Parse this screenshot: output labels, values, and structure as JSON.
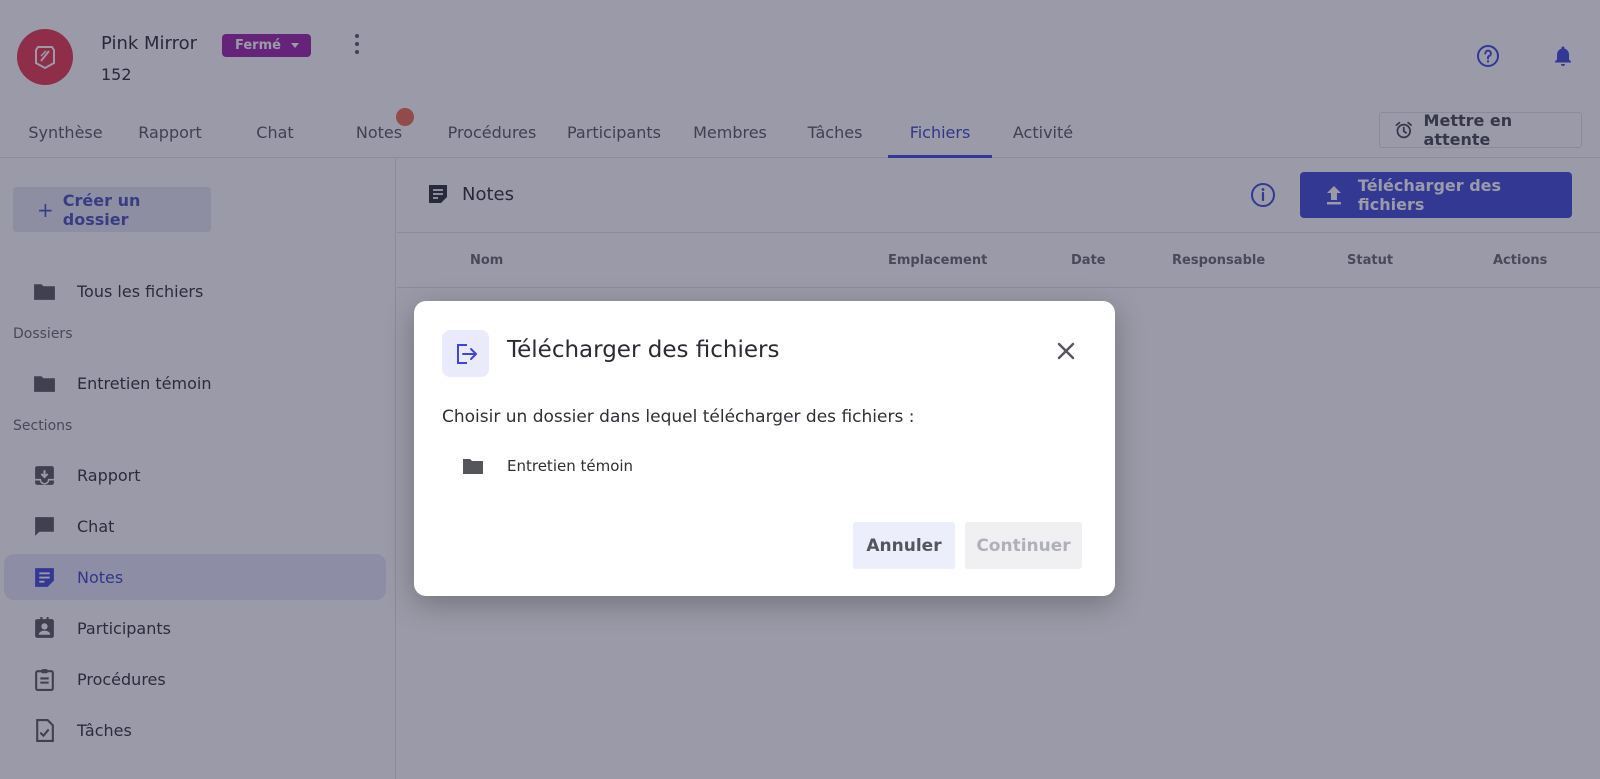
{
  "header": {
    "case_name": "Pink Mirror",
    "case_number": "152",
    "status": "Fermé",
    "hold_button": "Mettre en attente"
  },
  "tabs": [
    {
      "label": "Synthèse"
    },
    {
      "label": "Rapport"
    },
    {
      "label": "Chat"
    },
    {
      "label": "Notes"
    },
    {
      "label": "Procédures"
    },
    {
      "label": "Participants"
    },
    {
      "label": "Membres"
    },
    {
      "label": "Tâches"
    },
    {
      "label": "Fichiers",
      "active": true
    },
    {
      "label": "Activité"
    }
  ],
  "sidebar": {
    "create_button": "Créer un dossier",
    "all_files": "Tous les fichiers",
    "folders_heading": "Dossiers",
    "folders": [
      {
        "label": "Entretien témoin"
      }
    ],
    "sections_heading": "Sections",
    "sections": [
      {
        "label": "Rapport",
        "icon": "report-icon"
      },
      {
        "label": "Chat",
        "icon": "chat-icon"
      },
      {
        "label": "Notes",
        "icon": "notes-icon",
        "active": true
      },
      {
        "label": "Participants",
        "icon": "participants-icon"
      },
      {
        "label": "Procédures",
        "icon": "clipboard-icon"
      },
      {
        "label": "Tâches",
        "icon": "tasks-icon"
      }
    ]
  },
  "main": {
    "title": "Notes",
    "upload_button": "Télécharger des fichiers",
    "columns": [
      "Nom",
      "Emplacement",
      "Date",
      "Responsable",
      "Statut",
      "Actions"
    ]
  },
  "dialog": {
    "title": "Télécharger des fichiers",
    "text": "Choisir un dossier dans lequel télécharger des fichiers :",
    "folder": "Entretien témoin",
    "cancel": "Annuler",
    "continue": "Continuer"
  },
  "colors": {
    "accent": "#3e47d6",
    "status_badge": "#9c21a8",
    "logo": "#e8344a",
    "notification_dot": "#ef6b4c"
  }
}
